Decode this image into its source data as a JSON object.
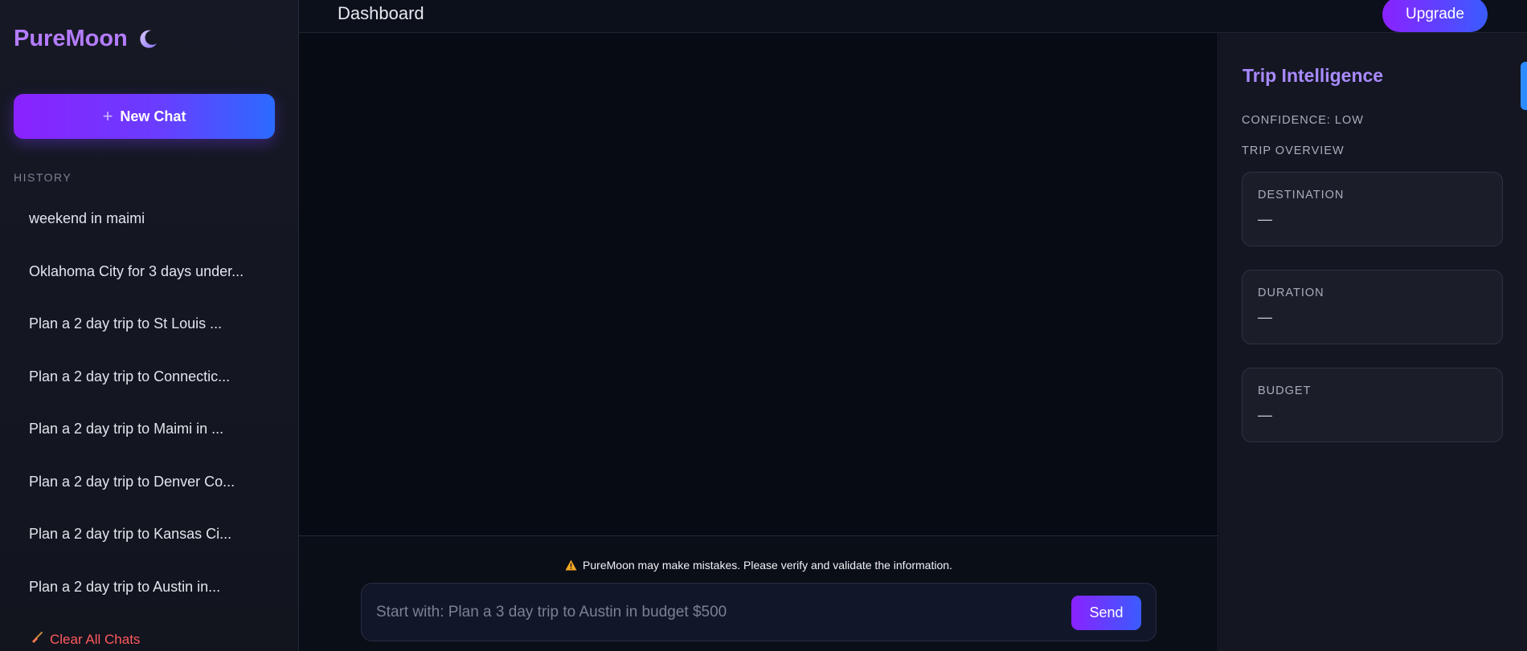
{
  "sidebar": {
    "brand": "PureMoon",
    "new_chat_label": "New Chat",
    "history_label": "HISTORY",
    "history": [
      "weekend in maimi",
      "Oklahoma City for 3 days under...",
      "Plan a 2 day trip to St Louis ...",
      "Plan a 2 day trip to Connectic...",
      "Plan a 2 day trip to Maimi in ...",
      "Plan a 2 day trip to Denver Co...",
      "Plan a 2 day trip to Kansas Ci...",
      "Plan a 2 day trip to Austin in..."
    ],
    "clear_all_label": "Clear All Chats"
  },
  "header": {
    "title": "Dashboard",
    "upgrade_label": "Upgrade"
  },
  "composer": {
    "disclaimer": "PureMoon may make mistakes. Please verify and validate the information.",
    "placeholder": "Start with: Plan a 3 day trip to Austin in budget $500",
    "value": "",
    "send_label": "Send"
  },
  "intel": {
    "title": "Trip Intelligence",
    "confidence": "CONFIDENCE: LOW",
    "overview_label": "TRIP OVERVIEW",
    "cards": [
      {
        "label": "DESTINATION",
        "value": "—"
      },
      {
        "label": "DURATION",
        "value": "—"
      },
      {
        "label": "BUDGET",
        "value": "—"
      }
    ]
  },
  "colors": {
    "accent_purple": "#8a22ff",
    "accent_blue": "#2b6bff",
    "brand": "#b57cff",
    "danger": "#ff5a5f",
    "background": "#0a0e17"
  },
  "icons": {
    "brand": "crescent-moon-icon",
    "new_chat": "plus-icon",
    "clear_all": "broom-icon",
    "disclaimer": "warning-icon"
  }
}
